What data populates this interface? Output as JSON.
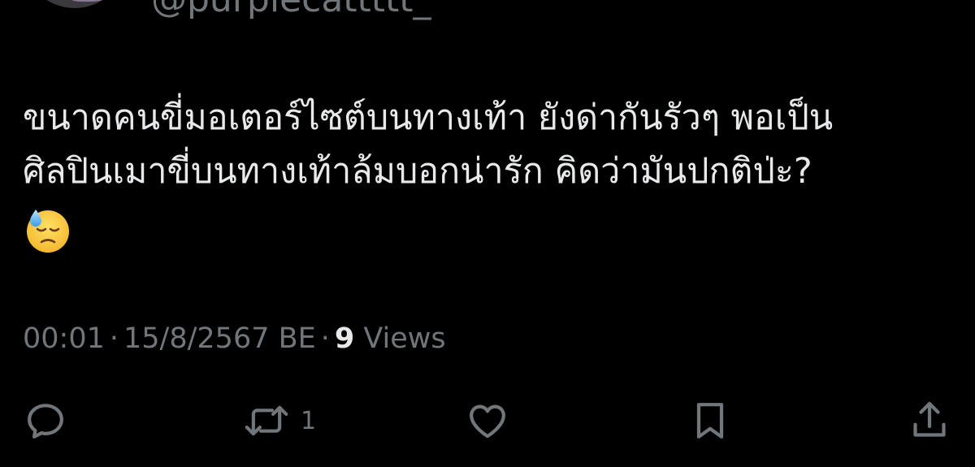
{
  "author": {
    "handle": "@purplecattttt_"
  },
  "tweet": {
    "lines": [
      "ขนาดคนขี่มอเตอร์ไซต์บนทางเท้า ยังด่ากันรัวๆ พอเป็น",
      "ศิลปินเมาขี่บนทางเท้าล้มบอกน่ารัก คิดว่ามันปกติป่ะ?"
    ],
    "emoji": "downcast-face-with-sweat"
  },
  "meta": {
    "time": "00:01",
    "date": "15/8/2567 BE",
    "views_count": "9",
    "views_label": "Views",
    "separator": "·"
  },
  "actions": {
    "reply_count": "",
    "retweet_count": "1",
    "like_count": "",
    "icons": [
      "reply-icon",
      "retweet-icon",
      "like-icon",
      "bookmark-icon",
      "share-icon"
    ]
  },
  "colors": {
    "background": "#000000",
    "text": "#e7e9ea",
    "secondary": "#71767b"
  }
}
